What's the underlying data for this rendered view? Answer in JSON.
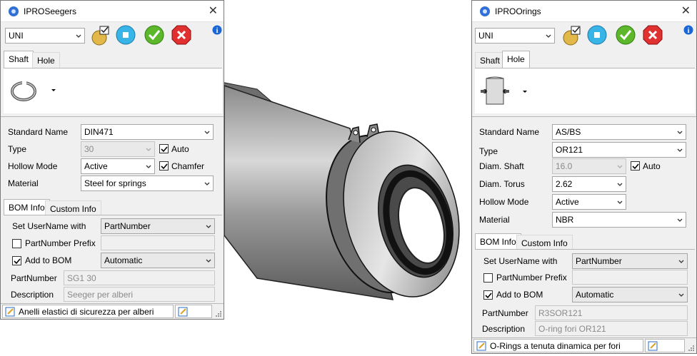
{
  "seegers": {
    "title": "IPROSeegers",
    "standard_select": "UNI",
    "tabs": [
      "Shaft",
      "Hole"
    ],
    "fields": {
      "standard_name_label": "Standard Name",
      "standard_name_value": "DIN471",
      "type_label": "Type",
      "type_value": "30",
      "auto_label": "Auto",
      "hollow_label": "Hollow Mode",
      "hollow_value": "Active",
      "chamfer_label": "Chamfer",
      "material_label": "Material",
      "material_value": "Steel for springs"
    },
    "bom_tabs": [
      "BOM Info",
      "Custom Info"
    ],
    "bom": {
      "set_username_label": "Set UserName with",
      "set_username_value": "PartNumber",
      "prefix_label": "PartNumber Prefix",
      "add_bom_label": "Add to BOM",
      "add_bom_value": "Automatic",
      "partnumber_label": "PartNumber",
      "partnumber_value": "SG1 30",
      "description_label": "Description",
      "description_value": "Seeger per alberi"
    },
    "status": "Anelli elastici di sicurezza per alberi"
  },
  "orings": {
    "title": "IPROOrings",
    "standard_select": "UNI",
    "tabs": [
      "Shaft",
      "Hole"
    ],
    "fields": {
      "standard_name_label": "Standard Name",
      "standard_name_value": "AS/BS",
      "type_label": "Type",
      "type_value": "OR121",
      "diam_shaft_label": "Diam. Shaft",
      "diam_shaft_value": "16.0",
      "auto_label": "Auto",
      "diam_torus_label": "Diam. Torus",
      "diam_torus_value": "2.62",
      "hollow_label": "Hollow Mode",
      "hollow_value": "Active",
      "material_label": "Material",
      "material_value": "NBR"
    },
    "bom_tabs": [
      "BOM Info",
      "Custom Info"
    ],
    "bom": {
      "set_username_label": "Set UserName with",
      "set_username_value": "PartNumber",
      "prefix_label": "PartNumber Prefix",
      "add_bom_label": "Add to BOM",
      "add_bom_value": "Automatic",
      "partnumber_label": "PartNumber",
      "partnumber_value": "R3SOR121",
      "description_label": "Description",
      "description_value": "O-ring fori OR121"
    },
    "status": "O-Rings a tenuta dinamica per fori"
  },
  "colors": {
    "accept": "#5cb82a",
    "cancel": "#e03030",
    "info": "#1a66d6",
    "select_blue": "#38b5e6"
  }
}
